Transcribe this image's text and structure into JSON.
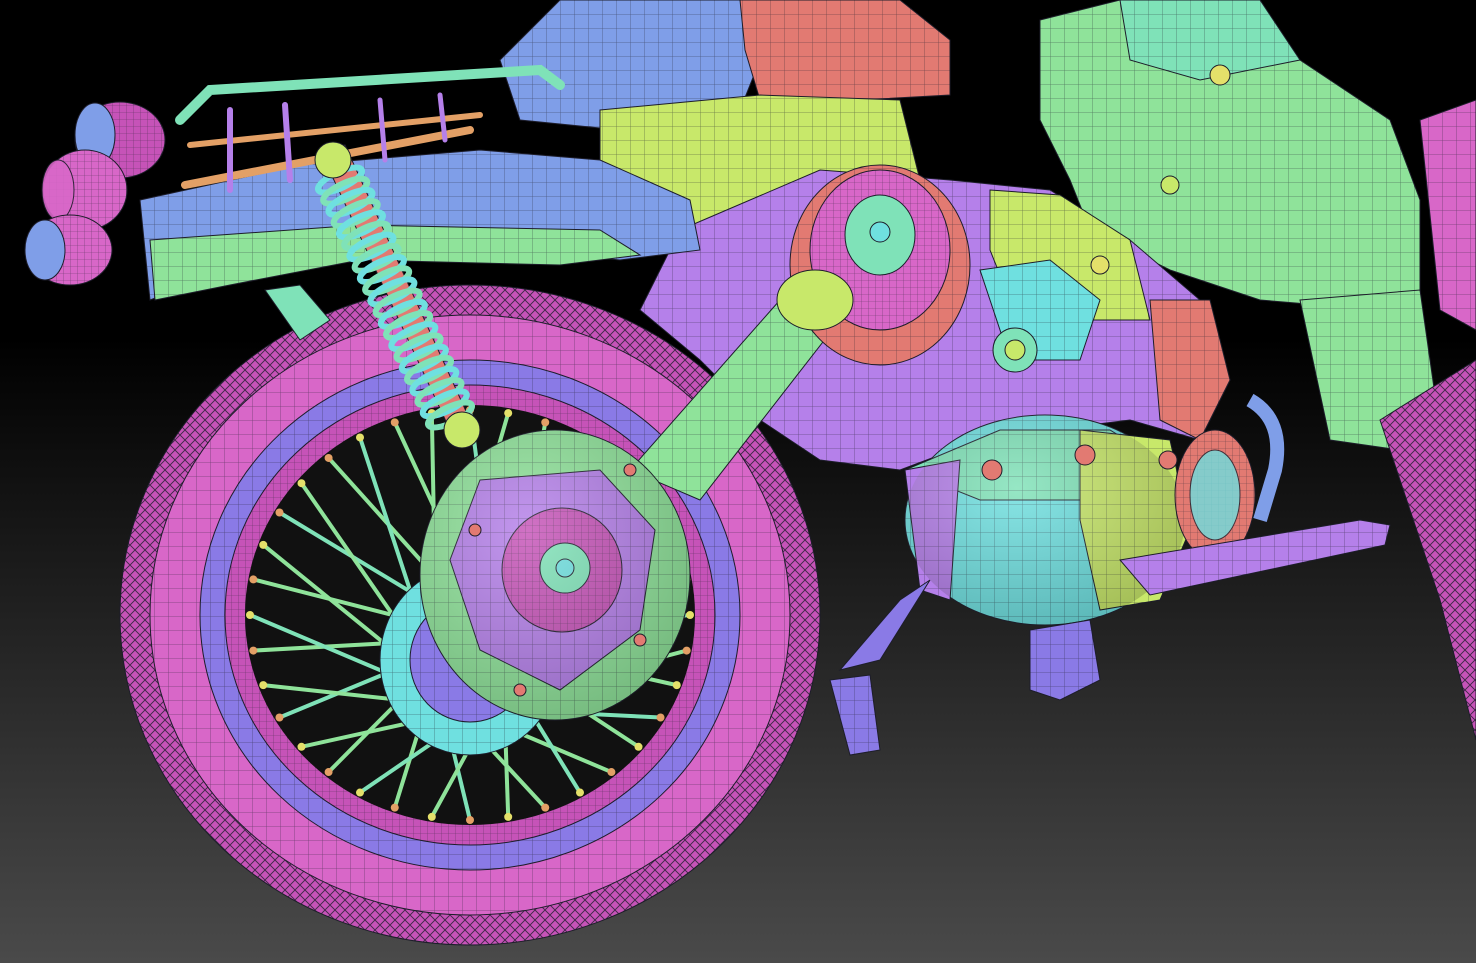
{
  "scene": {
    "background_top": "#000000",
    "background_bottom": "#4a4a4a",
    "palette": {
      "pink": "#d867c8",
      "magenta": "#c653b8",
      "violet": "#8a7ae6",
      "blue": "#7f9ee8",
      "green": "#8fe39a",
      "mint": "#7fe2b8",
      "cyan": "#6fe0e0",
      "lime": "#c8e86a",
      "yellow": "#e4e06a",
      "salmon": "#e27a72",
      "orange": "#e3a066",
      "purple": "#b580ea",
      "wire": "#1d1d2a"
    }
  }
}
